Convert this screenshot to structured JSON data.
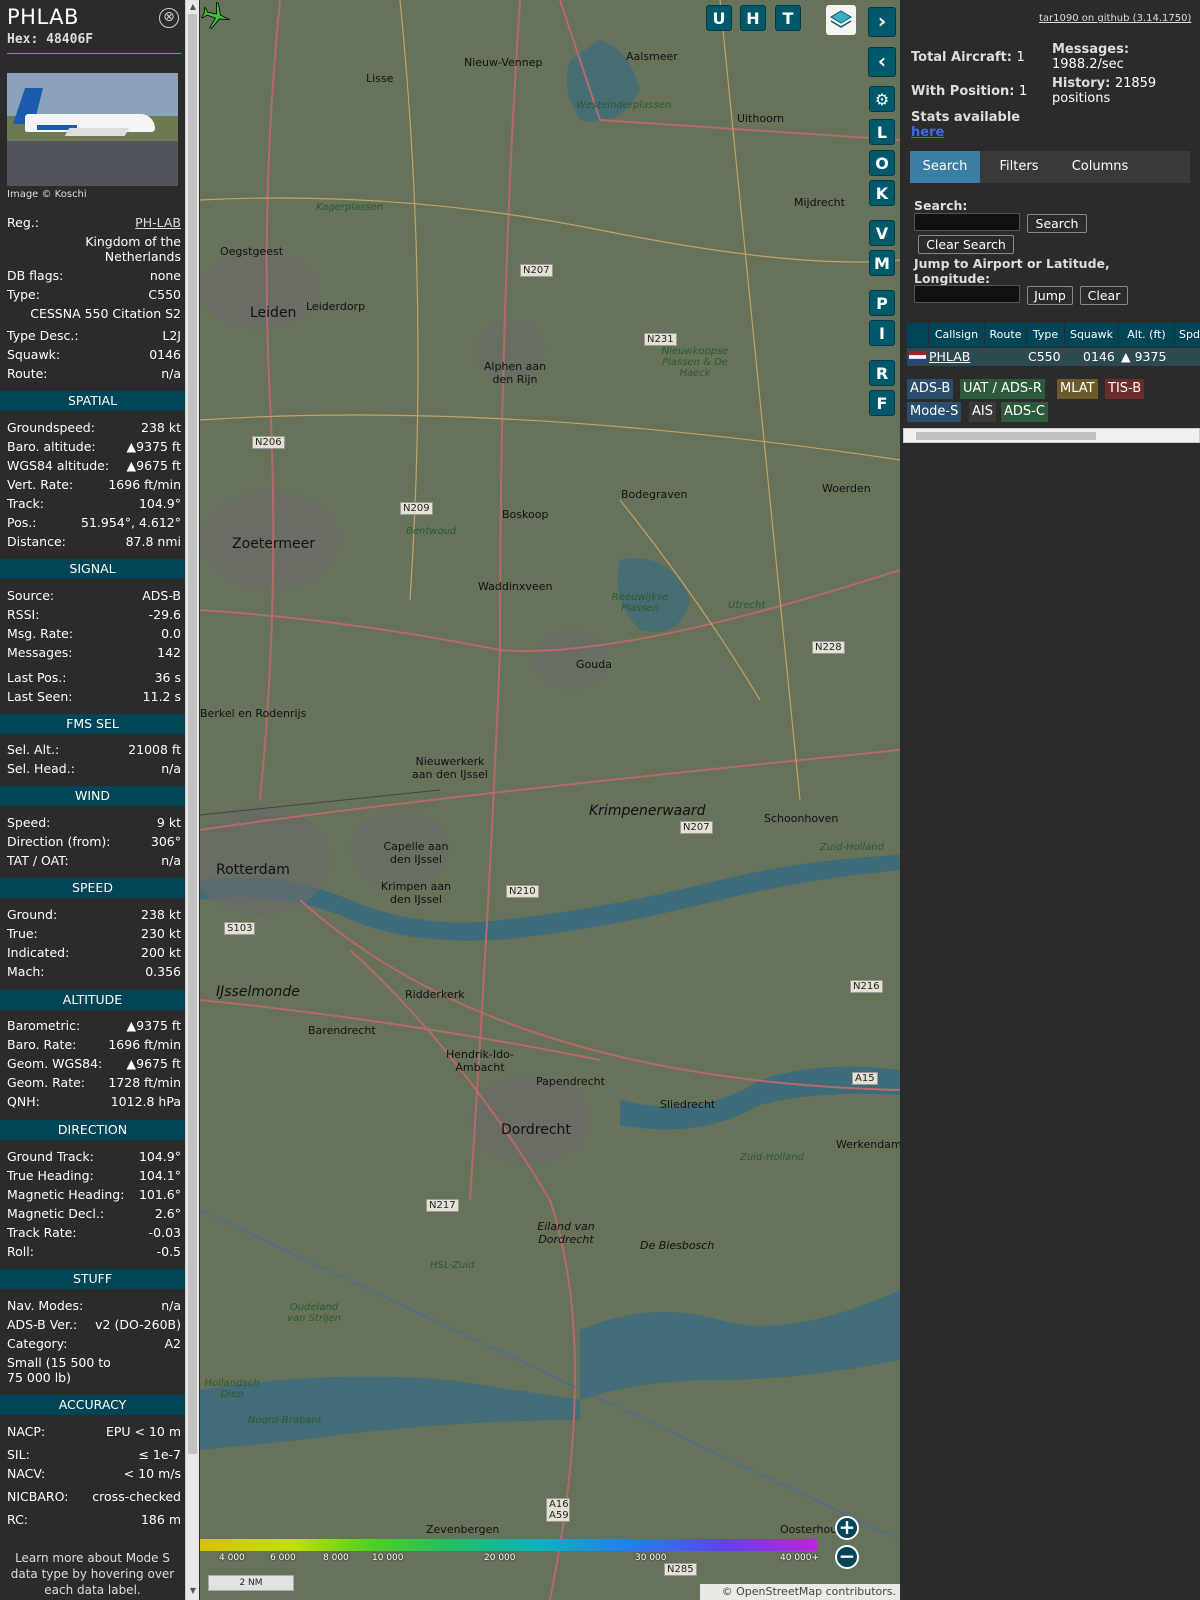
{
  "aircraft": {
    "title": "PHLAB",
    "hex": "Hex: 48406F",
    "photo_credit": "Image © Koschi",
    "close": "⊗"
  },
  "info": {
    "reg_label": "Reg.:",
    "reg": "PH-LAB",
    "country": "Kingdom of the Netherlands",
    "dbflags_label": "DB flags:",
    "dbflags": "none",
    "type_label": "Type:",
    "type": "C550",
    "type_name": "CESSNA 550 Citation S2",
    "typedesc_label": "Type Desc.:",
    "typedesc": "L2J",
    "squawk_label": "Squawk:",
    "squawk": "0146",
    "route_label": "Route:",
    "route": "n/a"
  },
  "spatial": {
    "header": "SPATIAL",
    "rows": [
      {
        "l": "Groundspeed:",
        "v": "238 kt"
      },
      {
        "l": "Baro. altitude:",
        "v": "▲9375 ft"
      },
      {
        "l": "WGS84 altitude:",
        "v": "▲9675 ft"
      },
      {
        "l": "Vert. Rate:",
        "v": "1696 ft/min"
      },
      {
        "l": "Track:",
        "v": "104.9°"
      },
      {
        "l": "Pos.:",
        "v": "51.954°, 4.612°"
      },
      {
        "l": "Distance:",
        "v": "87.8 nmi"
      }
    ]
  },
  "signal": {
    "header": "SIGNAL",
    "rows": [
      {
        "l": "Source:",
        "v": "ADS-B"
      },
      {
        "l": "RSSI:",
        "v": "-29.6"
      },
      {
        "l": "Msg. Rate:",
        "v": "0.0"
      },
      {
        "l": "Messages:",
        "v": "142"
      },
      {
        "l": "Last Pos.:",
        "v": "36 s"
      },
      {
        "l": "Last Seen:",
        "v": "11.2 s"
      }
    ]
  },
  "fms": {
    "header": "FMS SEL",
    "rows": [
      {
        "l": "Sel. Alt.:",
        "v": "21008 ft"
      },
      {
        "l": "Sel. Head.:",
        "v": "n/a"
      }
    ]
  },
  "wind": {
    "header": "WIND",
    "rows": [
      {
        "l": "Speed:",
        "v": "9 kt"
      },
      {
        "l": "Direction (from):",
        "v": "306°"
      },
      {
        "l": "TAT / OAT:",
        "v": "n/a"
      }
    ]
  },
  "speed": {
    "header": "SPEED",
    "rows": [
      {
        "l": "Ground:",
        "v": "238 kt"
      },
      {
        "l": "True:",
        "v": "230 kt"
      },
      {
        "l": "Indicated:",
        "v": "200 kt"
      },
      {
        "l": "Mach:",
        "v": "0.356"
      }
    ]
  },
  "altitude": {
    "header": "ALTITUDE",
    "rows": [
      {
        "l": "Barometric:",
        "v": "▲9375 ft"
      },
      {
        "l": "Baro. Rate:",
        "v": "1696 ft/min"
      },
      {
        "l": "Geom. WGS84:",
        "v": "▲9675 ft"
      },
      {
        "l": "Geom. Rate:",
        "v": "1728 ft/min"
      },
      {
        "l": "QNH:",
        "v": "1012.8 hPa"
      }
    ]
  },
  "direction": {
    "header": "DIRECTION",
    "rows": [
      {
        "l": "Ground Track:",
        "v": "104.9°"
      },
      {
        "l": "True Heading:",
        "v": "104.1°"
      },
      {
        "l": "Magnetic Heading:",
        "v": "101.6°"
      },
      {
        "l": "Magnetic Decl.:",
        "v": "2.6°"
      },
      {
        "l": "Track Rate:",
        "v": "-0.03"
      },
      {
        "l": "Roll:",
        "v": "-0.5"
      }
    ]
  },
  "stuff": {
    "header": "STUFF",
    "rows": [
      {
        "l": "Nav. Modes:",
        "v": "n/a"
      },
      {
        "l": "ADS-B Ver.:",
        "v": "v2 (DO-260B)"
      },
      {
        "l": "Category:",
        "v": "A2"
      }
    ],
    "category_desc": "Small (15 500 to 75 000 lb)"
  },
  "accuracy": {
    "header": "ACCURACY",
    "rows": [
      {
        "l": "NACP:",
        "v": "EPU < 10 m"
      },
      {
        "l": "SIL:",
        "v": "≤ 1e-7"
      },
      {
        "l": "NACV:",
        "v": "< 10 m/s"
      },
      {
        "l": "NICBARO:",
        "v": "cross-checked"
      },
      {
        "l": "RC:",
        "v": "186 m"
      }
    ]
  },
  "footnote": "Learn more about Mode S data type by hovering over each data label.",
  "map": {
    "buttons_top": [
      "U",
      "H",
      "T"
    ],
    "buttons_side": [
      "L",
      "O",
      "K",
      "V",
      "M",
      "P",
      "I",
      "R",
      "F"
    ],
    "labels": [
      "Nieuw-Vennep",
      "Aalsmeer",
      "Lisse",
      "Uithoorn",
      "Westeinderplassen",
      "Mijdrecht",
      "Kagerplassen",
      "Oegstgeest",
      "Leiden",
      "Leiderdorp",
      "Alphen aan den Rijn",
      "Nieuwkoopse Plassen & De Haeck",
      "Boskoop",
      "Bodegraven",
      "Woerden",
      "Zoetermeer",
      "Bentwoud",
      "Waddinxveen",
      "Reeuwijkse Plassen",
      "Gouda",
      "Berkel en Rodenrijs",
      "Nieuwerkerk aan den IJssel",
      "Krimpenerwaard",
      "Schoonhoven",
      "Rotterdam",
      "Capelle aan den IJssel",
      "Krimpen aan den IJssel",
      "IJsselmonde",
      "Ridderkerk",
      "Barendrecht",
      "Hendrik-Ido-Ambacht",
      "Papendrecht",
      "Sliedrecht",
      "Dordrecht",
      "Werkendam",
      "Eiland van Dordrecht",
      "De Biesbosch",
      "Oudeland van Strijen",
      "Hollandsch Diep",
      "Noord-Brabant",
      "Zevenbergen",
      "Oosterhout",
      "Zuid-Holland",
      "Utrecht",
      "Zuid-Holland",
      "HSL-Zuid"
    ],
    "roads": [
      "N207",
      "N231",
      "N206",
      "N209",
      "N228",
      "N207",
      "N210",
      "S103",
      "N216",
      "N217",
      "A15",
      "A16 A59",
      "N285"
    ],
    "altitude_scale": [
      "4 000",
      "6 000",
      "8 000",
      "10 000",
      "20 000",
      "30 000",
      "40 000+"
    ],
    "scale_text": "2 NM",
    "attribution": "© OpenStreetMap contributors."
  },
  "panel": {
    "github": "tar1090 on github (3.14.1750)",
    "total_aircraft_label": "Total Aircraft:",
    "total_aircraft": "1",
    "with_position_label": "With Position:",
    "with_position": "1",
    "messages_label": "Messages:",
    "messages": "1988.2/sec",
    "history_label": "History:",
    "history": "21859 positions",
    "stats_label": "Stats available",
    "stats_link": "here",
    "tabs": [
      "Search",
      "Filters",
      "Columns"
    ],
    "search_label": "Search:",
    "search_btn": "Search",
    "clear_search_btn": "Clear Search",
    "jump_label": "Jump to Airport or Latitude, Longitude:",
    "jump_btn": "Jump",
    "clear_btn": "Clear",
    "columns": [
      "Callsign",
      "Route",
      "Type",
      "Squawk",
      "Alt. (ft)",
      "Spd"
    ],
    "row": {
      "callsign": "PHLAB",
      "route": "",
      "type": "C550",
      "squawk": "0146",
      "alt": "▲ 9375"
    },
    "badges": [
      "ADS-B",
      "UAT / ADS-R",
      "MLAT",
      "TIS-B",
      "Mode-S",
      "AIS",
      "ADS-C"
    ]
  },
  "colors": {
    "accent": "#014557",
    "active_tab": "#3a7fa3",
    "map_bg": "#5e6b55"
  }
}
